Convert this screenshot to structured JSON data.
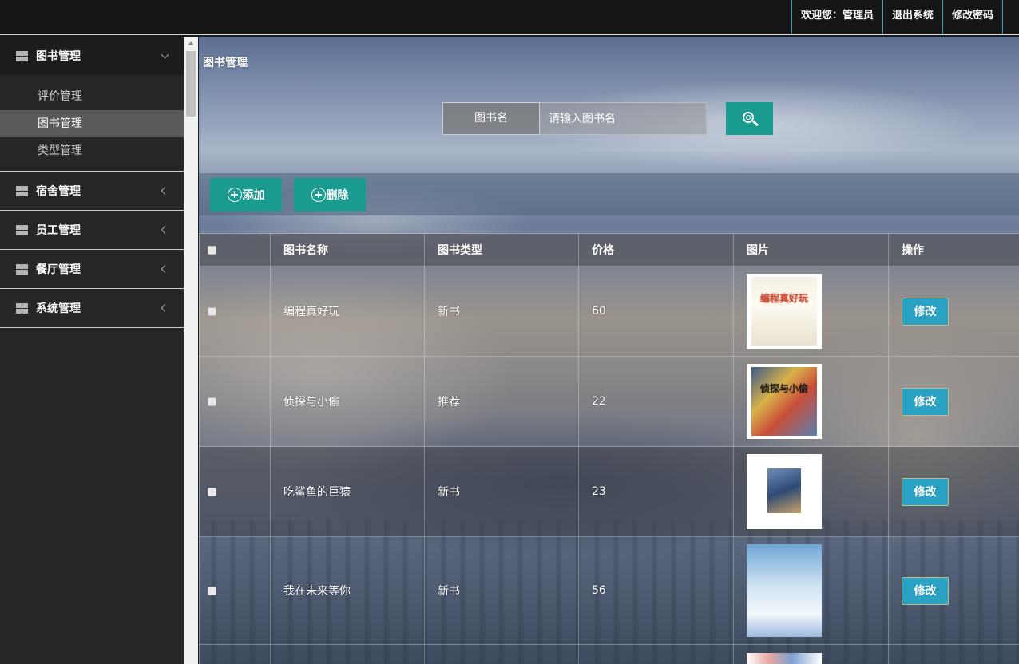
{
  "header": {
    "welcome": "欢迎您：管理员",
    "logout": "退出系统",
    "change_password": "修改密码"
  },
  "sidebar": {
    "groups": [
      {
        "label": "图书管理",
        "open": true,
        "items": [
          "评价管理",
          "图书管理",
          "类型管理"
        ],
        "active": "图书管理"
      },
      {
        "label": "宿舍管理"
      },
      {
        "label": "员工管理"
      },
      {
        "label": "餐厅管理"
      },
      {
        "label": "系统管理"
      }
    ]
  },
  "main": {
    "title": "图书管理",
    "search": {
      "label": "图书名",
      "placeholder": "请输入图书名"
    },
    "toolbar": {
      "add": "添加",
      "delete": "删除"
    },
    "table": {
      "columns": [
        "图书名称",
        "图书类型",
        "价格",
        "图片",
        "操作"
      ],
      "rows": [
        {
          "name": "编程真好玩",
          "type": "新书",
          "price": "60",
          "cover_title": "编程真好玩",
          "action": "修改"
        },
        {
          "name": "侦探与小偷",
          "type": "推荐",
          "price": "22",
          "cover_title": "侦探与小偷",
          "action": "修改"
        },
        {
          "name": "吃鲨鱼的巨猿",
          "type": "新书",
          "price": "23",
          "cover_title": "",
          "action": "修改"
        },
        {
          "name": "我在未来等你",
          "type": "新书",
          "price": "56",
          "cover_title": "",
          "action": "修改"
        }
      ]
    }
  },
  "colors": {
    "accent": "#1a9b8f",
    "edit": "#2aa2c4",
    "sidebar": "#262626",
    "topbar": "#151515"
  }
}
